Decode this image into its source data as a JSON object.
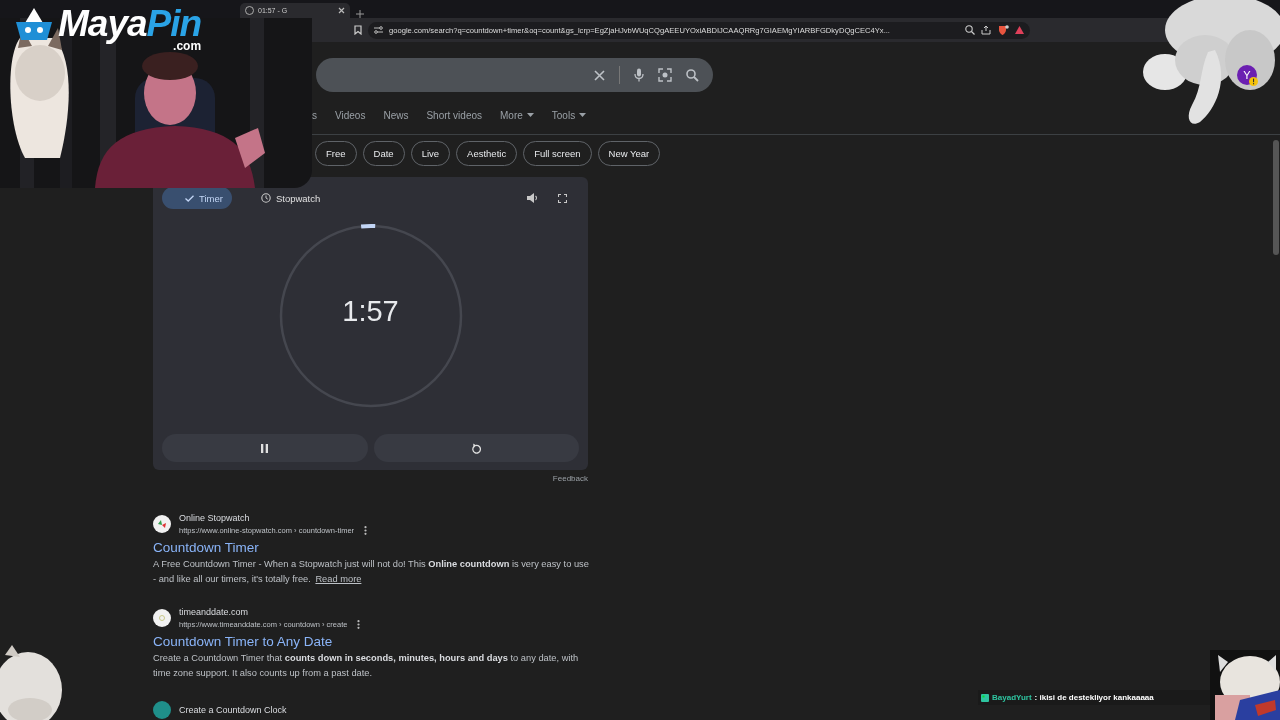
{
  "browser": {
    "tabs": [
      {
        "title": "01:57 - G",
        "selected": true
      }
    ],
    "address": "google.com/search?q=countdown+timer&oq=count&gs_lcrp=EgZjaHJvbWUqCQgAEEUYOxiABDIJCAAQRRg7GIAEMgYIARBFGDkyDQgCEC4Yx..."
  },
  "nav_tabs": [
    {
      "label": "s",
      "has_menu": false
    },
    {
      "label": "Videos",
      "has_menu": false
    },
    {
      "label": "News",
      "has_menu": false
    },
    {
      "label": "Short videos",
      "has_menu": false
    },
    {
      "label": "More",
      "has_menu": true
    },
    {
      "label": "Tools",
      "has_menu": true
    }
  ],
  "chips": [
    "Free",
    "Date",
    "Live",
    "Aesthetic",
    "Full screen",
    "New Year"
  ],
  "account": {
    "initial": "Y",
    "warning": true
  },
  "timer": {
    "modes": [
      {
        "label": "Timer",
        "kind": "timer",
        "selected": true
      },
      {
        "label": "Stopwatch",
        "kind": "stopwatch",
        "selected": false
      }
    ],
    "time": "1:57",
    "level": 0.025
  },
  "feedback": "Feedback",
  "results": [
    {
      "site": "Online Stopwatch",
      "url": "https://www.online-stopwatch.com › countdown-timer",
      "title": "Countdown Timer",
      "snippet": "A Free Countdown Timer - When a Stopwatch just will not do! This **Online countdown** is very easy to use - and like all our timers, it's totally free.",
      "more": "Read more"
    },
    {
      "site": "timeanddate.com",
      "url": "https://www.timeanddate.com › countdown › create",
      "title": "Countdown Timer to Any Date",
      "snippet": "Create a Countdown Timer that **counts down in seconds, minutes, hours and days** to any date, with time zone support. It also counts up from a past date."
    },
    {
      "site": "Create a Countdown Clock"
    }
  ],
  "overlay": {
    "logo": {
      "words": [
        {
          "text": "Maya",
          "color": "#ffffff"
        },
        {
          "text": "Pin",
          "color": "#2aa3e6"
        }
      ],
      "domain": ".com"
    },
    "chat": {
      "user": "BayadYurt",
      "message": ": ikisi de destekliyor kankaaaaa"
    }
  }
}
